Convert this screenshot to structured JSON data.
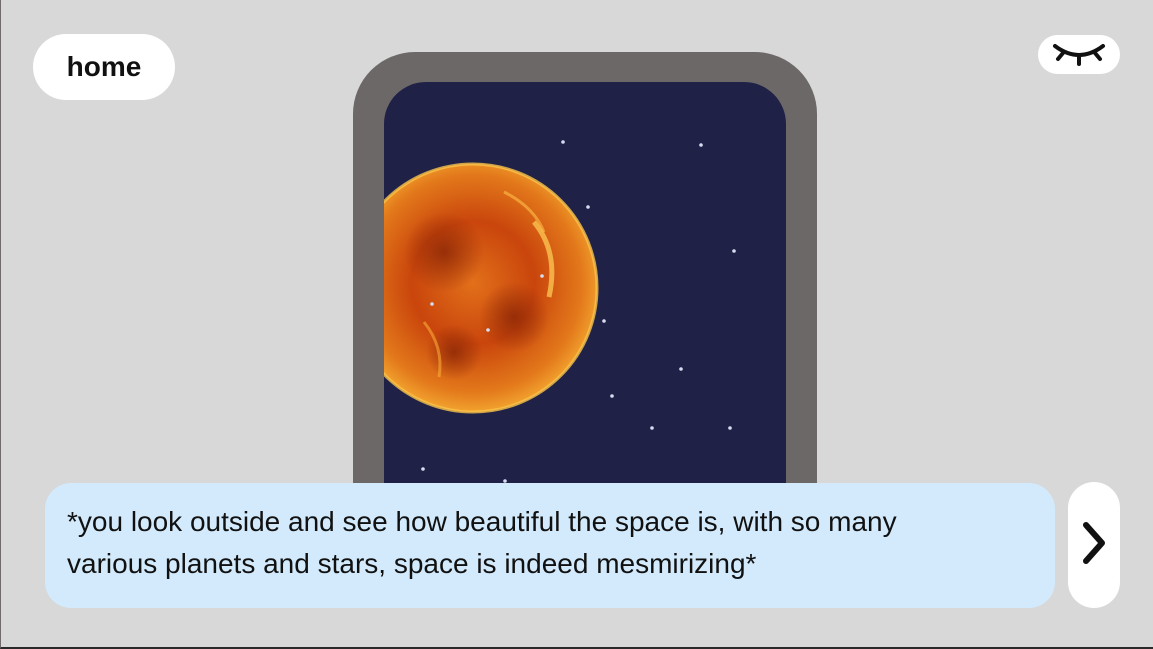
{
  "nav": {
    "home_label": "home"
  },
  "controls": {
    "hide_icon": "closed-eye-icon",
    "next_icon": "chevron-right-icon"
  },
  "scene": {
    "planet": "sun-planet",
    "colors": {
      "space": "#1f2147",
      "frame": "#6d6868",
      "planet_core": "#c9450c",
      "planet_glow": "#f7b236"
    }
  },
  "dialog": {
    "line1": "*you look outside and see how beautiful the space is, with so many",
    "line2": "various planets and stars, space is indeed mesmirizing*"
  }
}
